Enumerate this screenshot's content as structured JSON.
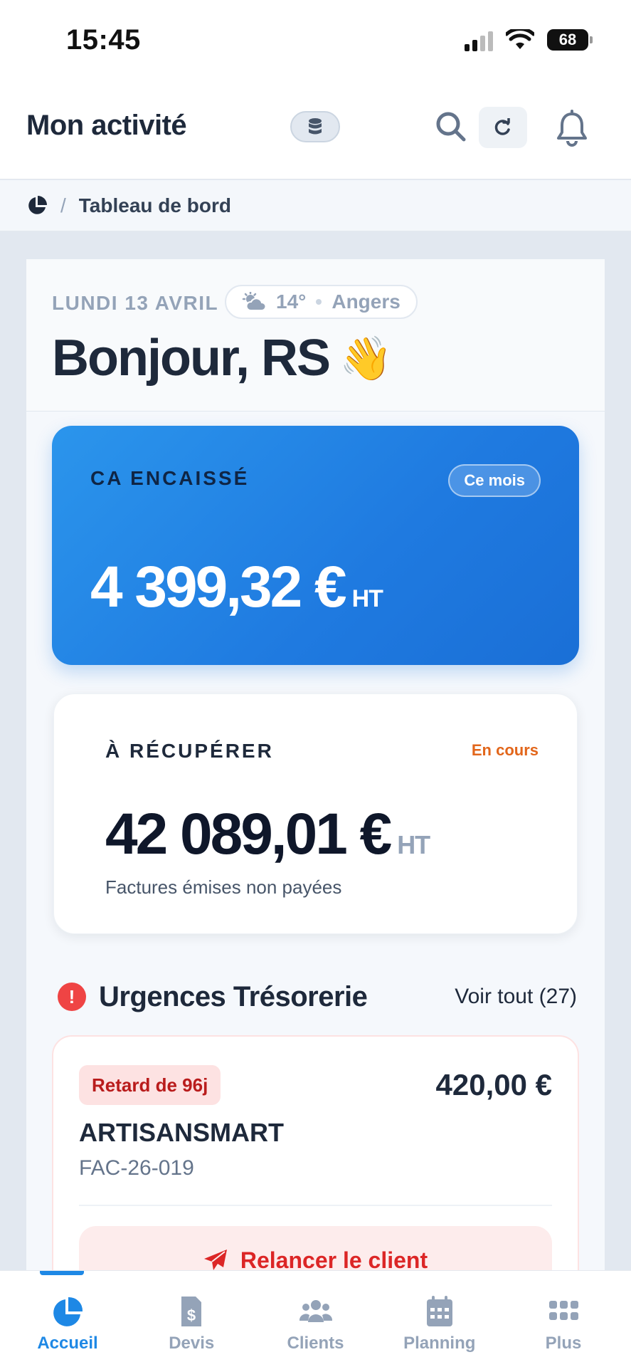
{
  "status_bar": {
    "time": "15:45",
    "battery": "68"
  },
  "header": {
    "title": "Mon activité",
    "icons": [
      "database-icon",
      "search-icon",
      "refresh-icon",
      "bell-icon"
    ]
  },
  "breadcrumb": {
    "separator": "/",
    "current": "Tableau de bord"
  },
  "greeting_block": {
    "date": "LUNDI 13 AVRIL",
    "weather": {
      "temperature": "14°",
      "city": "Angers"
    },
    "greeting": "Bonjour, RS",
    "emoji": "👋"
  },
  "ca_card": {
    "label": "CA ENCAISSÉ",
    "period": "Ce mois",
    "amount": "4 399,32 €",
    "unit": "HT",
    "color": "#1f7ae0"
  },
  "recover_card": {
    "label": "À RÉCUPÉRER",
    "status": "En cours",
    "amount": "42 089,01 €",
    "unit": "HT",
    "subtitle": "Factures émises non payées",
    "status_color": "#e2661b"
  },
  "urgences": {
    "title": "Urgences Trésorerie",
    "see_all": "Voir tout (27)",
    "items": [
      {
        "badge": "Retard de 96j",
        "amount": "420,00 €",
        "client": "ARTISANSMART",
        "reference": "FAC-26-019",
        "action": "Relancer le client"
      }
    ]
  },
  "nav": {
    "items": [
      {
        "label": "Accueil",
        "icon": "pie-chart-icon",
        "active": true
      },
      {
        "label": "Devis",
        "icon": "invoice-icon",
        "active": false
      },
      {
        "label": "Clients",
        "icon": "users-icon",
        "active": false
      },
      {
        "label": "Planning",
        "icon": "calendar-icon",
        "active": false
      },
      {
        "label": "Plus",
        "icon": "grid-icon",
        "active": false
      }
    ]
  }
}
